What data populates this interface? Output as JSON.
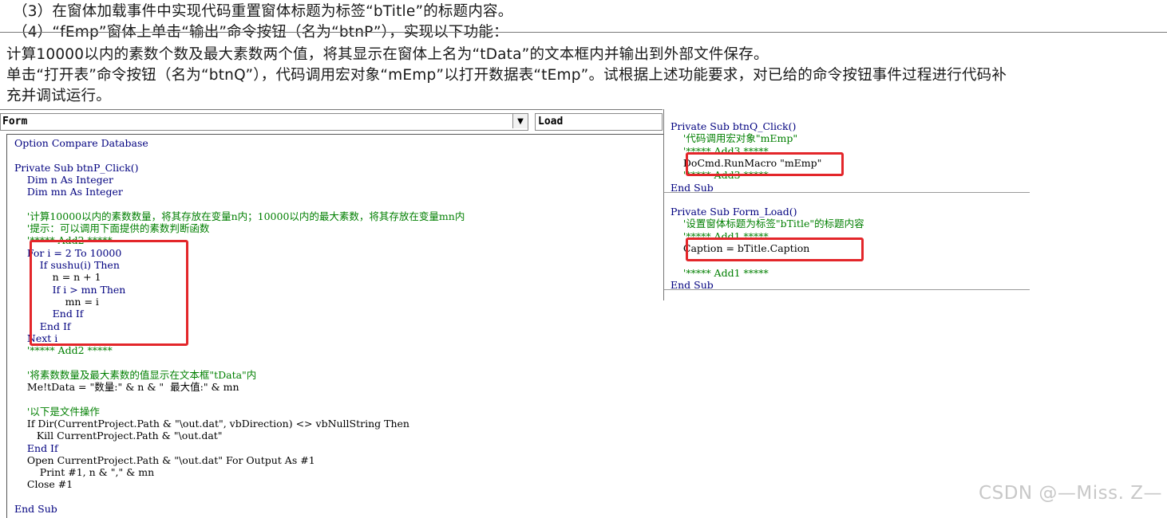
{
  "instructions": [
    "（3）在窗体加载事件中实现代码重置窗体标题为标签“bTitle”的标题内容。",
    "（4）“fEmp”窗体上单击“输出”命令按钮（名为“btnP”），实现以下功能：",
    "计算10000以内的素数个数及最大素数两个值，将其显示在窗体上名为“tData”的文本框内并输出到外部文件保存。",
    "单击“打开表”命令按钮（名为“btnQ”），代码调用宏对象“mEmp”以打开数据表“tEmp”。试根据上述功能要求，对已给的命令按钮事件过程进行代码补",
    "充并调试运行。"
  ],
  "left_editor": {
    "object_combo": "Form",
    "proc_combo": "Load",
    "code": [
      {
        "text": "Option Compare Database",
        "kind": "kw"
      },
      {
        "text": "",
        "kind": "tx"
      },
      {
        "text": "Private Sub btnP_Click()",
        "kind": "kw"
      },
      {
        "text": "    Dim n As Integer",
        "kind": "kw"
      },
      {
        "text": "    Dim mn As Integer",
        "kind": "kw"
      },
      {
        "text": "",
        "kind": "tx"
      },
      {
        "text": "    '计算10000以内的素数数量，将其存放在变量n内；10000以内的最大素数，将其存放在变量mn内",
        "kind": "cm"
      },
      {
        "text": "    '提示：可以调用下面提供的素数判断函数",
        "kind": "cm"
      },
      {
        "text": "    '***** Add2 *****",
        "kind": "cm"
      },
      {
        "text": "    For i = 2 To 10000",
        "kind": "kw"
      },
      {
        "text": "        If sushu(i) Then",
        "kind": "kw"
      },
      {
        "text": "            n = n + 1",
        "kind": "tx"
      },
      {
        "text": "            If i > mn Then",
        "kind": "kw"
      },
      {
        "text": "                mn = i",
        "kind": "tx"
      },
      {
        "text": "            End If",
        "kind": "kw"
      },
      {
        "text": "        End If",
        "kind": "kw"
      },
      {
        "text": "    Next i",
        "kind": "kw"
      },
      {
        "text": "    '***** Add2 *****",
        "kind": "cm"
      },
      {
        "text": "",
        "kind": "tx"
      },
      {
        "text": "    '将素数数量及最大素数的值显示在文本框\"tData\"内",
        "kind": "cm"
      },
      {
        "text": "    Me!tData = \"数量:\" & n & \"  最大值:\" & mn",
        "kind": "tx"
      },
      {
        "text": "",
        "kind": "tx"
      },
      {
        "text": "    '以下是文件操作",
        "kind": "cm"
      },
      {
        "text": "    If Dir(CurrentProject.Path & \"\\out.dat\", vbDirection) <> vbNullString Then",
        "kind": "tx"
      },
      {
        "text": "       Kill CurrentProject.Path & \"\\out.dat\"",
        "kind": "tx"
      },
      {
        "text": "    End If",
        "kind": "kw"
      },
      {
        "text": "    Open CurrentProject.Path & \"\\out.dat\" For Output As #1",
        "kind": "tx"
      },
      {
        "text": "        Print #1, n & \",\" & mn",
        "kind": "tx"
      },
      {
        "text": "    Close #1",
        "kind": "tx"
      },
      {
        "text": "",
        "kind": "tx"
      },
      {
        "text": "End Sub",
        "kind": "kw"
      }
    ]
  },
  "right_editor": {
    "code_top": [
      {
        "text": "Private Sub btnQ_Click()",
        "kind": "kw"
      },
      {
        "text": "    '代码调用宏对象\"mEmp\"",
        "kind": "cm"
      },
      {
        "text": "    '***** Add3 *****",
        "kind": "cm"
      },
      {
        "text": "    DoCmd.RunMacro \"mEmp\"",
        "kind": "tx"
      },
      {
        "text": "    '***** Add3 *****",
        "kind": "cm"
      },
      {
        "text": "End Sub",
        "kind": "kw"
      }
    ],
    "code_bottom": [
      {
        "text": "Private Sub Form_Load()",
        "kind": "kw"
      },
      {
        "text": "    '设置窗体标题为标签\"bTitle\"的标题内容",
        "kind": "cm"
      },
      {
        "text": "    '***** Add1 *****",
        "kind": "cm"
      },
      {
        "text": "    Caption = bTitle.Caption",
        "kind": "tx"
      },
      {
        "text": "",
        "kind": "tx"
      },
      {
        "text": "    '***** Add1 *****",
        "kind": "cm"
      },
      {
        "text": "End Sub",
        "kind": "kw"
      }
    ]
  },
  "watermark": "CSDN @—Miss. Z—"
}
